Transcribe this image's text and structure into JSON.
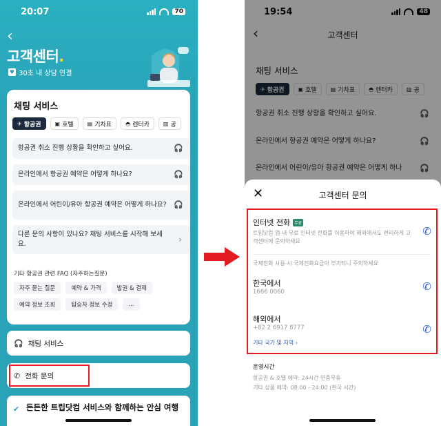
{
  "left": {
    "status": {
      "time": "20:07",
      "battery": "70"
    },
    "header": {
      "title": "고객센터",
      "title_dot": ".",
      "subtitle": "30초 내 상담 연결"
    },
    "chat_card": {
      "title": "채팅 서비스",
      "tabs": [
        {
          "label": "항공권",
          "icon": "plane-icon",
          "active": true
        },
        {
          "label": "호텔",
          "icon": "hotel-icon",
          "active": false
        },
        {
          "label": "기차표",
          "icon": "train-icon",
          "active": false
        },
        {
          "label": "렌터카",
          "icon": "car-icon",
          "active": false
        },
        {
          "label": "공",
          "icon": "bus-icon",
          "active": false
        }
      ],
      "questions": [
        "항공권 취소 진행 상황을 확인하고 싶어요.",
        "온라인에서 항공권 예약은 어떻게 하나요?",
        "온라인에서 어린이/유아 항공권 예약은 어떻게 하나요?",
        "다른 문의 사항이 있나요? 채팅 서비스를 시작해 보세요."
      ],
      "faq_title": "기타 항공권  관련 FAQ (자주하는질문)",
      "faq_tags": [
        "자주 묻는 질문",
        "예약 & 가격",
        "발권 & 결제",
        "예약 정보 조회",
        "탑승자 정보 수정",
        "..."
      ]
    },
    "options": {
      "chat": "채팅 서비스",
      "phone": "전화 문의"
    },
    "banner": "든든한 트립닷컴 서비스와 함께하는 안심 여행"
  },
  "right": {
    "status": {
      "time": "19:54",
      "battery": "48"
    },
    "header": {
      "title": "고객센터"
    },
    "background": {
      "section": "채팅 서비스",
      "tabs": [
        "항공권",
        "호텔",
        "기차표",
        "렌터카",
        "공"
      ],
      "questions": [
        "항공권 취소 진행 상황을 확인하고 싶어요.",
        "온라인에서 항공권 예약은 어떻게 하나요?",
        "온라인에서 어린이/유아 항공권 예약은 어떻게 하나"
      ]
    },
    "sheet": {
      "title": "고객센터 문의",
      "internet": {
        "label": "인터넷 전화",
        "badge": "무료",
        "desc": "트립닷컴 앱 내 무료 인터넷 전화를 이용하여 해외에서도 편리하게 고객센터에 문의하세요"
      },
      "note": "국제전화 사용 시 국제전화요금이 부과되니 주의하세요",
      "korea": {
        "label": "한국에서",
        "number": "1666 0060"
      },
      "abroad": {
        "label": "해외에서",
        "number": "+82 2 6917 8777"
      },
      "other_link": "기타 국가 및 지역",
      "hours_title": "운영시간",
      "hours": [
        "항공권 & 호텔 예약: 24시간 연중무휴",
        "기타 상품 예약: 08:00 - 24:00 (한국 시간)"
      ]
    }
  },
  "colors": {
    "teal": "#2aa3b8",
    "highlight": "#e31b23",
    "link": "#2a5fd8",
    "navy": "#1b2a3d"
  }
}
